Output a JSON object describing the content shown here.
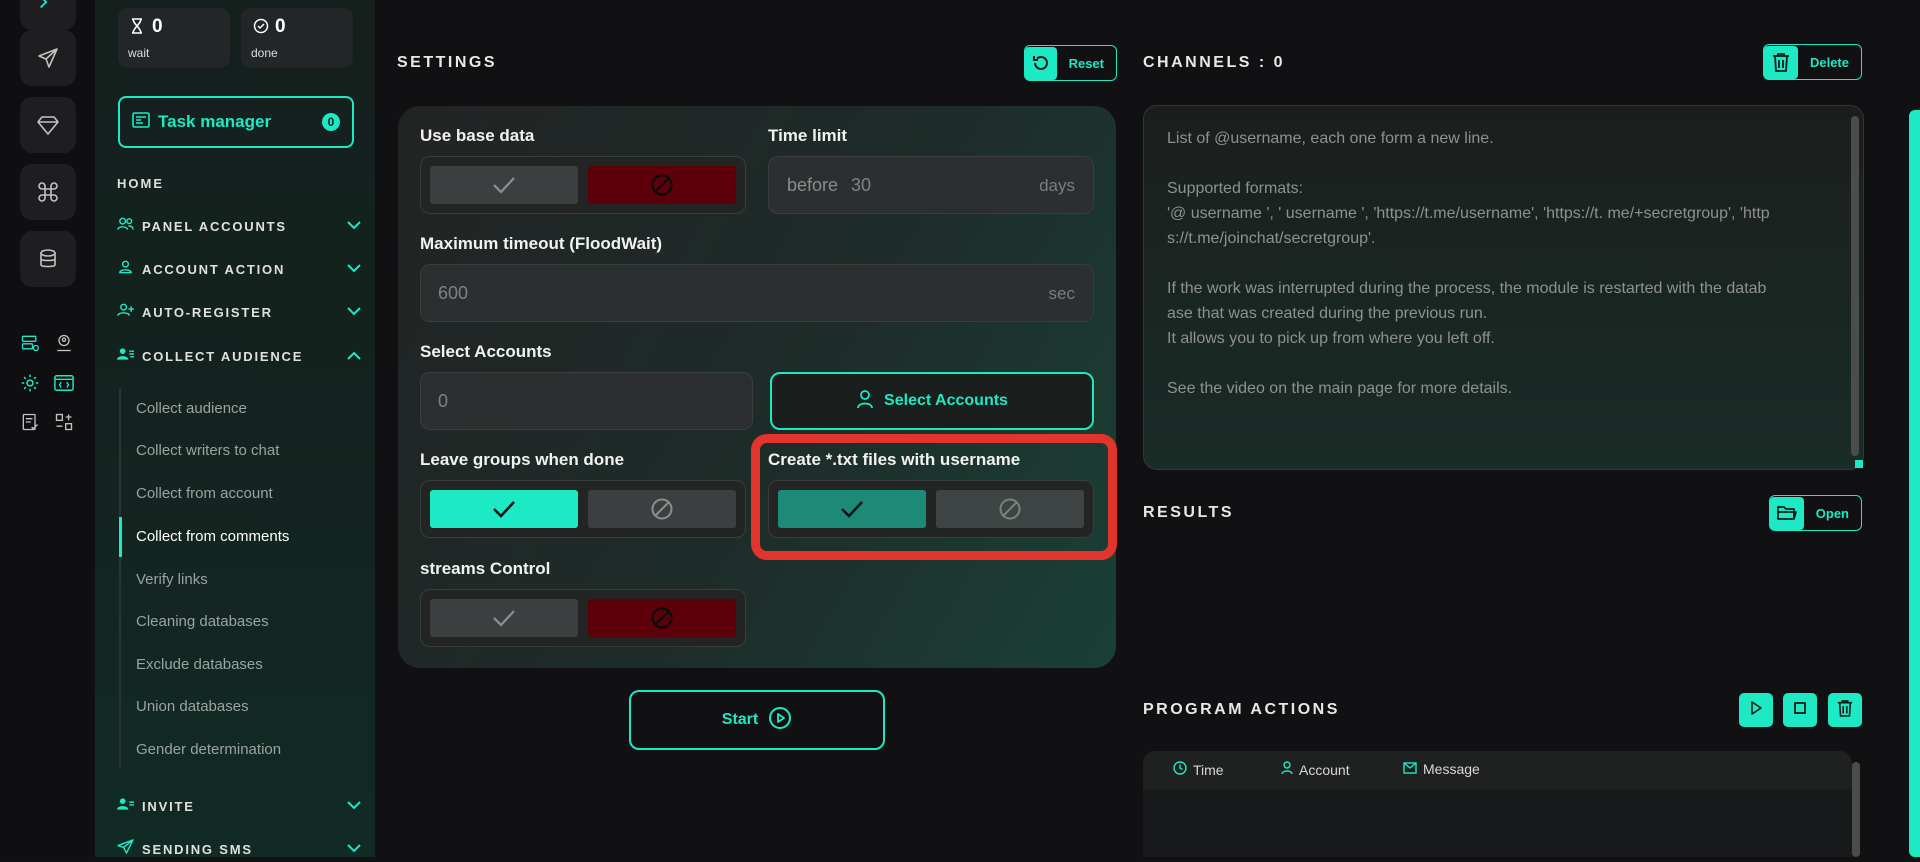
{
  "stats": {
    "wait": {
      "count": "0",
      "label": "wait"
    },
    "done": {
      "count": "0",
      "label": "done"
    }
  },
  "sidebar": {
    "task_manager": {
      "label": "Task manager",
      "count": "0"
    },
    "home": "HOME",
    "groups": [
      {
        "label": "PANEL ACCOUNTS"
      },
      {
        "label": "ACCOUNT ACTION"
      },
      {
        "label": "AUTO-REGISTER"
      },
      {
        "label": "COLLECT AUDIENCE"
      },
      {
        "label": "INVITE"
      },
      {
        "label": "SENDING SMS"
      }
    ],
    "collect_items": [
      "Collect audience",
      "Collect writers to chat",
      "Collect from account",
      "Collect from comments",
      "Verify links",
      "Cleaning databases",
      "Exclude databases",
      "Union databases",
      "Gender determination"
    ],
    "active_item": "Collect from comments"
  },
  "settings": {
    "title": "SETTINGS",
    "reset_label": "Reset",
    "use_base_data": {
      "label": "Use base data",
      "value": "off"
    },
    "time_limit": {
      "label": "Time limit",
      "prefix": "before",
      "value": "30",
      "suffix": "days"
    },
    "max_timeout": {
      "label": "Maximum timeout (FloodWait)",
      "value": "600",
      "suffix": "sec"
    },
    "select_accounts": {
      "label": "Select Accounts",
      "value": "0",
      "button_label": "Select Accounts"
    },
    "leave_groups": {
      "label": "Leave groups when done",
      "value": "on"
    },
    "create_txt": {
      "label": "Create *.txt files with username",
      "value": "on"
    },
    "streams_control": {
      "label": "streams Control",
      "value": "off"
    },
    "start_label": "Start"
  },
  "channels": {
    "title": "CHANNELS : 0",
    "delete_label": "Delete",
    "placeholder": "List of @username, each one form a new line.\n\nSupported formats:\n'@ username ', ' username ', 'https://t.me/username', 'https://t. me/+secretgroup', 'http\ns://t.me/joinchat/secretgroup'.\n\nIf the work was interrupted during the process, the module is restarted with the datab\nase that was created during the previous run.\nIt allows you to pick up from where you left off.\n\nSee the video on the main page for more details."
  },
  "results": {
    "title": "RESULTS",
    "open_label": "Open"
  },
  "program_actions": {
    "title": "PROGRAM ACTIONS",
    "columns": [
      "Time",
      "Account",
      "Message"
    ]
  },
  "colors": {
    "accent": "#1de9c4",
    "danger": "#5e000a",
    "highlight": "#e0342c"
  }
}
